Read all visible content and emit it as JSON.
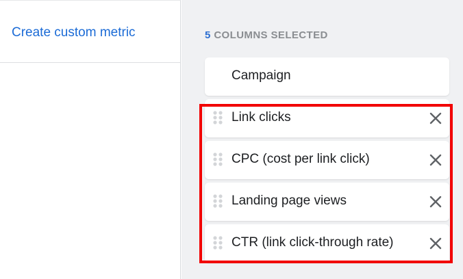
{
  "left_pane": {
    "create_metric_label": "Create custom metric"
  },
  "right_pane": {
    "selected_count": "5",
    "selected_label": "COLUMNS SELECTED",
    "columns": [
      {
        "label": "Campaign",
        "removable": false,
        "draggable": false
      },
      {
        "label": "Link clicks",
        "removable": true,
        "draggable": true
      },
      {
        "label": "CPC (cost per link click)",
        "removable": true,
        "draggable": true
      },
      {
        "label": "Landing page views",
        "removable": true,
        "draggable": true
      },
      {
        "label": "CTR (link click-through rate)",
        "removable": true,
        "draggable": true
      }
    ]
  },
  "icons": {
    "drag_handle": "drag-handle-icon",
    "remove": "close-icon"
  },
  "colors": {
    "link": "#1b6bd6",
    "count_accent": "#2d6fd1",
    "highlight": "#f20000",
    "panel_bg": "#f0f1f3"
  }
}
